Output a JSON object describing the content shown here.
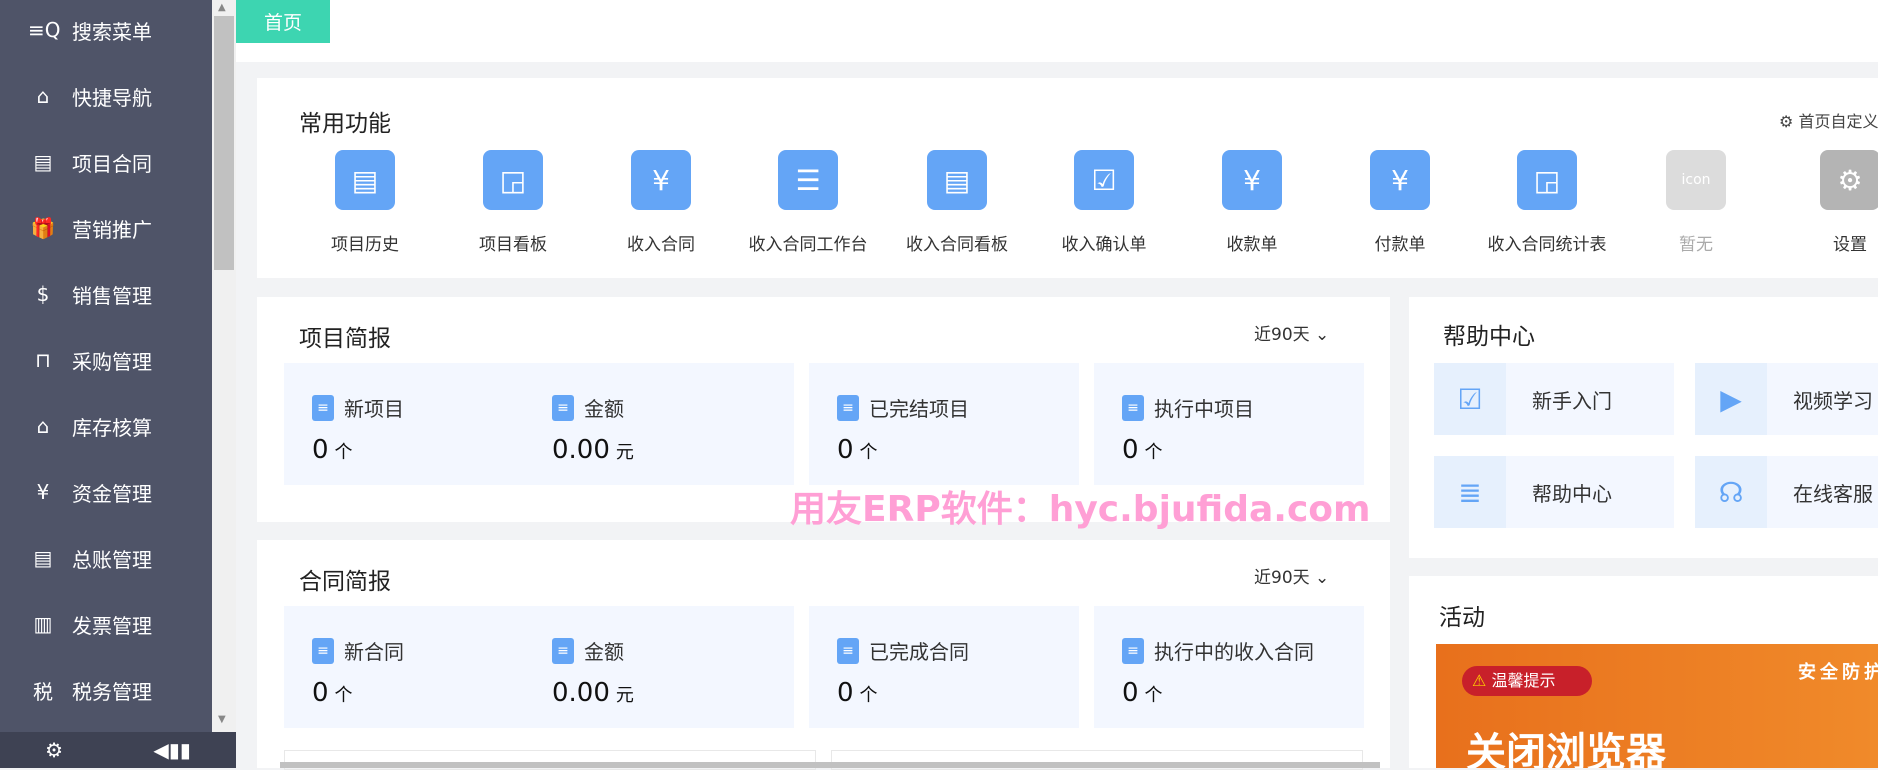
{
  "sidebar": {
    "items": [
      {
        "label": "搜索菜单",
        "icon": "search-menu-icon",
        "glyph": "≡Q"
      },
      {
        "label": "快捷导航",
        "icon": "home-icon",
        "glyph": "⌂"
      },
      {
        "label": "项目合同",
        "icon": "contract-icon",
        "glyph": "▤"
      },
      {
        "label": "营销推广",
        "icon": "gift-icon",
        "glyph": "🎁"
      },
      {
        "label": "销售管理",
        "icon": "sales-icon",
        "glyph": "$"
      },
      {
        "label": "采购管理",
        "icon": "bag-icon",
        "glyph": "⊓"
      },
      {
        "label": "库存核算",
        "icon": "warehouse-icon",
        "glyph": "⌂"
      },
      {
        "label": "资金管理",
        "icon": "money-bag-icon",
        "glyph": "¥"
      },
      {
        "label": "总账管理",
        "icon": "ledger-icon",
        "glyph": "▤"
      },
      {
        "label": "发票管理",
        "icon": "invoice-icon",
        "glyph": "▥"
      },
      {
        "label": "税务管理",
        "icon": "tax-icon",
        "glyph": "税"
      }
    ],
    "bottom": {
      "settings": "⚙",
      "collapse": "◀▮▮"
    }
  },
  "tabs": [
    {
      "label": "首页",
      "active": true,
      "color": "#3dd5b1"
    }
  ],
  "quick": {
    "title": "常用功能",
    "customize": "首页自定义",
    "items": [
      {
        "label": "项目历史",
        "glyph": "▤"
      },
      {
        "label": "项目看板",
        "glyph": "◲"
      },
      {
        "label": "收入合同",
        "glyph": "¥"
      },
      {
        "label": "收入合同工作台",
        "glyph": "☰"
      },
      {
        "label": "收入合同看板",
        "glyph": "▤"
      },
      {
        "label": "收入确认单",
        "glyph": "☑"
      },
      {
        "label": "收款单",
        "glyph": "¥"
      },
      {
        "label": "付款单",
        "glyph": "¥"
      },
      {
        "label": "收入合同统计表",
        "glyph": "◲"
      },
      {
        "label": "暂无",
        "glyph": "icon",
        "disabled": true
      },
      {
        "label": "设置",
        "glyph": "⚙",
        "gray": true
      }
    ]
  },
  "project": {
    "title": "项目简报",
    "range": "近90天",
    "stats": [
      {
        "label": "新项目",
        "value": "0",
        "unit": "个"
      },
      {
        "label": "金额",
        "value": "0.00",
        "unit": "元"
      },
      {
        "label": "已完结项目",
        "value": "0",
        "unit": "个"
      },
      {
        "label": "执行中项目",
        "value": "0",
        "unit": "个"
      }
    ]
  },
  "contract": {
    "title": "合同简报",
    "range": "近90天",
    "stats": [
      {
        "label": "新合同",
        "value": "0",
        "unit": "个"
      },
      {
        "label": "金额",
        "value": "0.00",
        "unit": "元"
      },
      {
        "label": "已完成合同",
        "value": "0",
        "unit": "个"
      },
      {
        "label": "执行中的收入合同",
        "value": "0",
        "unit": "个"
      }
    ]
  },
  "help": {
    "title": "帮助中心",
    "items": [
      {
        "label": "新手入门",
        "glyph": "☑"
      },
      {
        "label": "视频学习",
        "glyph": "▶"
      },
      {
        "label": "帮助中心",
        "glyph": "≣"
      },
      {
        "label": "在线客服",
        "glyph": "☊"
      }
    ]
  },
  "activity": {
    "title": "活动",
    "banner": {
      "badge": "温馨提示",
      "headline": "关闭浏览器",
      "side": "安全防护"
    }
  },
  "watermark": "用友ERP软件：hyc.bjufida.com",
  "colors": {
    "sidebar": "#4f5468",
    "accent": "#3dd5b1",
    "icon_blue": "#64a5f6"
  }
}
